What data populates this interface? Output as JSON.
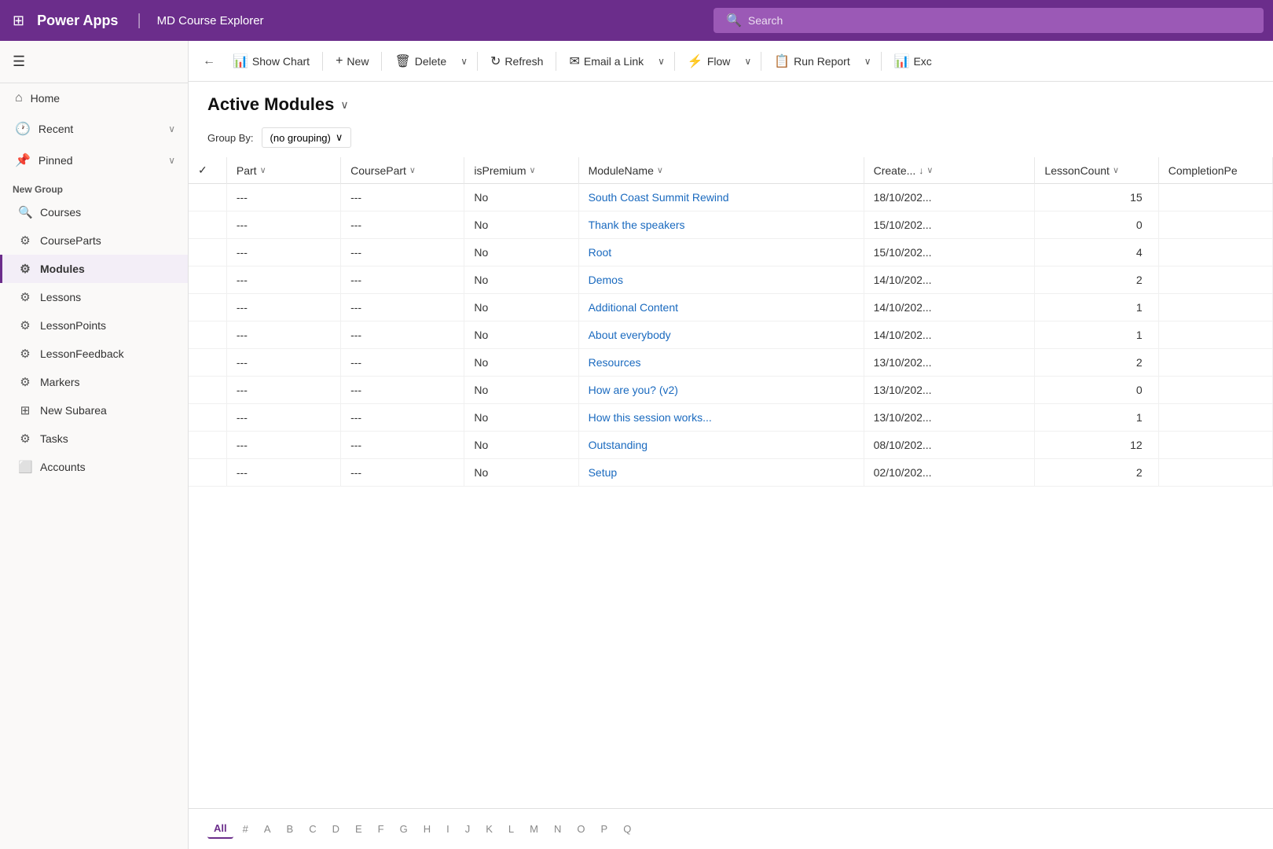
{
  "header": {
    "app_name": "Power Apps",
    "app_subtitle": "MD Course Explorer",
    "search_placeholder": "Search"
  },
  "sidebar": {
    "hamburger_label": "☰",
    "nav_items": [
      {
        "id": "home",
        "icon": "⌂",
        "label": "Home",
        "has_chevron": false
      },
      {
        "id": "recent",
        "icon": "🕐",
        "label": "Recent",
        "has_chevron": true
      },
      {
        "id": "pinned",
        "icon": "📌",
        "label": "Pinned",
        "has_chevron": true
      }
    ],
    "section_title": "New Group",
    "section_items": [
      {
        "id": "courses",
        "icon": "🔍",
        "label": "Courses",
        "active": false
      },
      {
        "id": "courseparts",
        "icon": "⚙",
        "label": "CourseParts",
        "active": false
      },
      {
        "id": "modules",
        "icon": "⚙",
        "label": "Modules",
        "active": true
      },
      {
        "id": "lessons",
        "icon": "⚙",
        "label": "Lessons",
        "active": false
      },
      {
        "id": "lessonpoints",
        "icon": "⚙",
        "label": "LessonPoints",
        "active": false
      },
      {
        "id": "lessonfeedback",
        "icon": "⚙",
        "label": "LessonFeedback",
        "active": false
      },
      {
        "id": "markers",
        "icon": "⚙",
        "label": "Markers",
        "active": false
      },
      {
        "id": "newsubarea",
        "icon": "⊞",
        "label": "New Subarea",
        "active": false
      },
      {
        "id": "tasks",
        "icon": "⚙",
        "label": "Tasks",
        "active": false
      },
      {
        "id": "accounts",
        "icon": "⬜",
        "label": "Accounts",
        "active": false
      }
    ]
  },
  "toolbar": {
    "back_icon": "←",
    "show_chart_label": "Show Chart",
    "new_label": "New",
    "delete_label": "Delete",
    "refresh_label": "Refresh",
    "email_link_label": "Email a Link",
    "flow_label": "Flow",
    "run_report_label": "Run Report",
    "excel_label": "Exc"
  },
  "page": {
    "title": "Active Modules",
    "group_by_label": "Group By:",
    "group_by_value": "(no grouping)"
  },
  "table": {
    "columns": [
      {
        "id": "check",
        "label": "✓",
        "sortable": false
      },
      {
        "id": "part",
        "label": "Part",
        "sortable": true
      },
      {
        "id": "coursepart",
        "label": "CoursePart",
        "sortable": true
      },
      {
        "id": "ispremium",
        "label": "isPremium",
        "sortable": true
      },
      {
        "id": "modulename",
        "label": "ModuleName",
        "sortable": true
      },
      {
        "id": "created",
        "label": "Create...",
        "sortable": true,
        "sorted": true
      },
      {
        "id": "lessoncount",
        "label": "LessonCount",
        "sortable": true
      },
      {
        "id": "completionpe",
        "label": "CompletionPe",
        "sortable": false
      }
    ],
    "rows": [
      {
        "part": "---",
        "coursepart": "---",
        "ispremium": "No",
        "modulename": "South Coast Summit Rewind",
        "created": "18/10/202...",
        "lessoncount": 15,
        "completionpe": ""
      },
      {
        "part": "---",
        "coursepart": "---",
        "ispremium": "No",
        "modulename": "Thank the speakers",
        "created": "15/10/202...",
        "lessoncount": 0,
        "completionpe": ""
      },
      {
        "part": "---",
        "coursepart": "---",
        "ispremium": "No",
        "modulename": "Root",
        "created": "15/10/202...",
        "lessoncount": 4,
        "completionpe": ""
      },
      {
        "part": "---",
        "coursepart": "---",
        "ispremium": "No",
        "modulename": "Demos",
        "created": "14/10/202...",
        "lessoncount": 2,
        "completionpe": ""
      },
      {
        "part": "---",
        "coursepart": "---",
        "ispremium": "No",
        "modulename": "Additional Content",
        "created": "14/10/202...",
        "lessoncount": 1,
        "completionpe": ""
      },
      {
        "part": "---",
        "coursepart": "---",
        "ispremium": "No",
        "modulename": "About everybody",
        "created": "14/10/202...",
        "lessoncount": 1,
        "completionpe": ""
      },
      {
        "part": "---",
        "coursepart": "---",
        "ispremium": "No",
        "modulename": "Resources",
        "created": "13/10/202...",
        "lessoncount": 2,
        "completionpe": ""
      },
      {
        "part": "---",
        "coursepart": "---",
        "ispremium": "No",
        "modulename": "How are you? (v2)",
        "created": "13/10/202...",
        "lessoncount": 0,
        "completionpe": ""
      },
      {
        "part": "---",
        "coursepart": "---",
        "ispremium": "No",
        "modulename": "How this session works...",
        "created": "13/10/202...",
        "lessoncount": 1,
        "completionpe": ""
      },
      {
        "part": "---",
        "coursepart": "---",
        "ispremium": "No",
        "modulename": "Outstanding",
        "created": "08/10/202...",
        "lessoncount": 12,
        "completionpe": ""
      },
      {
        "part": "---",
        "coursepart": "---",
        "ispremium": "No",
        "modulename": "Setup",
        "created": "02/10/202...",
        "lessoncount": 2,
        "completionpe": ""
      }
    ]
  },
  "pagination": {
    "items": [
      "All",
      "#",
      "A",
      "B",
      "C",
      "D",
      "E",
      "F",
      "G",
      "H",
      "I",
      "J",
      "K",
      "L",
      "M",
      "N",
      "O",
      "P",
      "Q"
    ],
    "active": "All"
  },
  "colors": {
    "brand_purple": "#6b2d8b",
    "active_border": "#6b2d8b"
  }
}
